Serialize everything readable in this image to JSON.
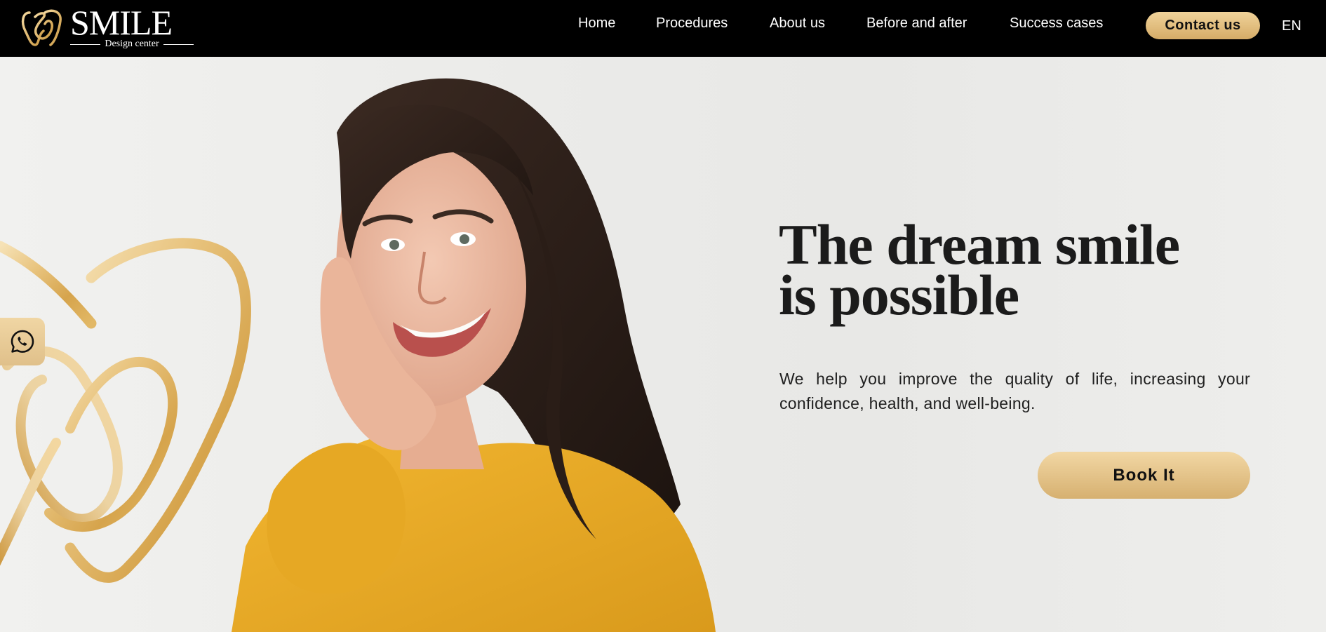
{
  "brand": {
    "name": "SMILE",
    "tagline": "Design center",
    "gold": "#d9b270",
    "gold_light": "#f0d39a"
  },
  "nav": {
    "items": [
      {
        "label": "Home"
      },
      {
        "label": "Procedures"
      },
      {
        "label": "About us"
      },
      {
        "label": "Before and after"
      },
      {
        "label": "Success cases"
      }
    ],
    "contact_label": "Contact us",
    "language": "EN"
  },
  "hero": {
    "headline_line1": "The dream smile",
    "headline_line2": "is possible",
    "subtext": "We help you improve the quality of life, increasing your confidence, health, and well-being.",
    "cta_label": "Book It",
    "image": "smiling-woman-photo"
  },
  "floating": {
    "whatsapp_icon": "whatsapp-icon"
  }
}
